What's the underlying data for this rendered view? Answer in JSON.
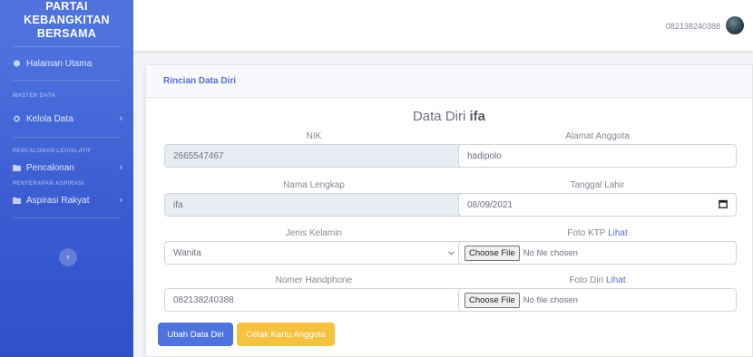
{
  "sidebar": {
    "brand": [
      "PARTAI",
      "KEBANGKITAN",
      "BERSAMA"
    ],
    "items": {
      "home": "Halaman Utama",
      "master_heading": "MASTER DATA",
      "kelola": "Kelola Data",
      "pencalonan_heading": "PENCALONAN LEGISLATIF",
      "pencalonan": "Pencalonan",
      "penyerapan_heading": "PENYERAPAN ASPIRASI",
      "aspirasi": "Aspirasi Rakyat"
    },
    "chevron": "›",
    "toggle_icon": "‹"
  },
  "topbar": {
    "user_phone": "082138240388"
  },
  "card": {
    "header": "Rincian Data Diri",
    "title_prefix": "Data Diri",
    "title_name": "ifa"
  },
  "form": {
    "nik": {
      "label": "NIK",
      "value": "2665547467"
    },
    "alamat": {
      "label": "Alamat Anggota",
      "value": "hadipolo"
    },
    "nama": {
      "label": "Nama Lengkap",
      "value": "ifa"
    },
    "tanggal": {
      "label": "Tanggal Lahir",
      "value": "08/09/2021"
    },
    "jenis": {
      "label": "Jenis Kelamin",
      "value": "Wanita"
    },
    "foto_ktp": {
      "label": "Foto KTP",
      "link": "Lihat",
      "button": "Choose File",
      "status": "No file chosen"
    },
    "hp": {
      "label": "Nomer Handphone",
      "value": "082138240388"
    },
    "foto_diri": {
      "label": "Foto Diri",
      "link": "Lihat",
      "button": "Choose File",
      "status": "No file chosen"
    }
  },
  "buttons": {
    "ubah": "Ubah Data Diri",
    "cetak": "Cetak Kartu Anggota"
  },
  "colors": {
    "primary": "#4e73df",
    "warning": "#f6c23e",
    "sidebar": "#4e73df"
  }
}
